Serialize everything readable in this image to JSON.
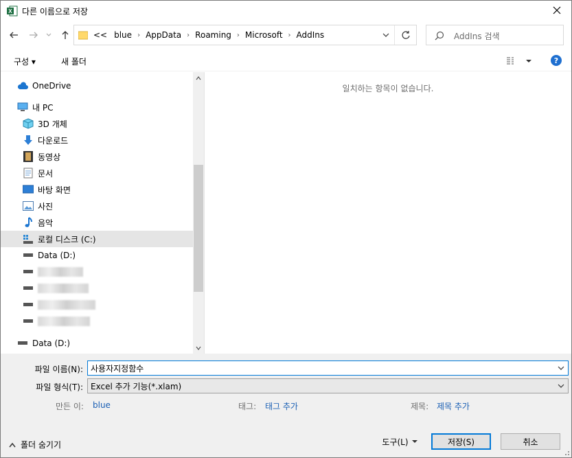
{
  "window": {
    "title": "다른 이름으로 저장"
  },
  "nav": {
    "breadcrumbs": [
      "<<",
      "blue",
      "AppData",
      "Roaming",
      "Microsoft",
      "AddIns"
    ],
    "search_placeholder": "AddIns 검색"
  },
  "commandbar": {
    "organize": "구성 ▾",
    "new_folder": "새 폴더"
  },
  "navpane": {
    "items": [
      {
        "label": "OneDrive",
        "icon": "cloud-icon"
      },
      {
        "label": "내 PC",
        "icon": "computer-icon"
      },
      {
        "label": "3D 개체",
        "icon": "cube-icon"
      },
      {
        "label": "다운로드",
        "icon": "download-arrow-icon"
      },
      {
        "label": "동영상",
        "icon": "film-icon"
      },
      {
        "label": "문서",
        "icon": "document-icon"
      },
      {
        "label": "바탕 화면",
        "icon": "desktop-icon"
      },
      {
        "label": "사진",
        "icon": "picture-icon"
      },
      {
        "label": "음악",
        "icon": "music-note-icon"
      },
      {
        "label": "로컬 디스크 (C:)",
        "icon": "windows-drive-icon"
      },
      {
        "label": "Data (D:)",
        "icon": "drive-icon"
      },
      {
        "label": "Data (D:)",
        "icon": "drive-icon"
      }
    ]
  },
  "filepane": {
    "empty_message": "일치하는 항목이 없습니다."
  },
  "bottom": {
    "filename_label": "파일 이름(N):",
    "filename_value": "사용자지정함수",
    "filetype_label": "파일 형식(T):",
    "filetype_value": "Excel 추가 기능(*.xlam)",
    "authors_label": "만든 이:",
    "authors_value": "blue",
    "tags_label": "태그:",
    "tags_value": "태그 추가",
    "title_label": "제목:",
    "title_value": "제목 추가",
    "hide_folders": "폴더 숨기기",
    "tools_button": "도구(L)",
    "save_button": "저장(S)",
    "cancel_button": "취소"
  },
  "colors": {
    "accent": "#0078d7",
    "link": "#1a5fb4",
    "excel_green": "#1d6f42"
  }
}
